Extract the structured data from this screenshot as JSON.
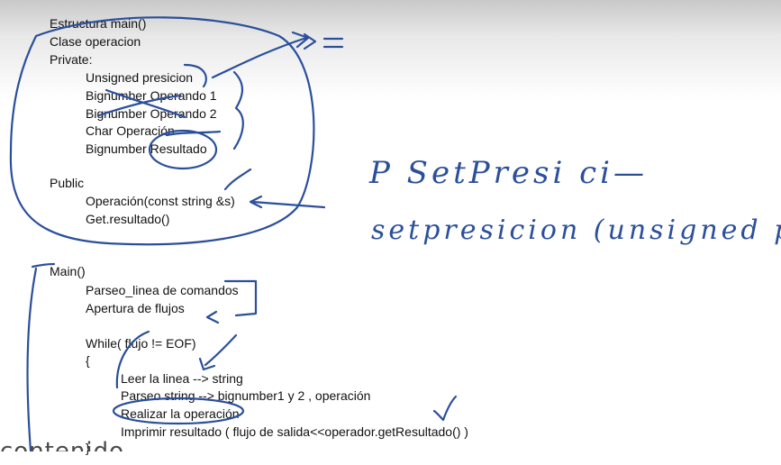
{
  "document": {
    "lines": [
      "Estructura main()",
      "Clase operacion",
      "Private:",
      "Unsigned presicion",
      "Bignumber Operando 1",
      "Bignumber Operando 2",
      "Char Operación",
      "Bignumber Resultado",
      "Public",
      "Operación(const string &s)",
      "Get.resultado()",
      "Main()",
      "Parseo_linea de comandos",
      "Apertura de flujos",
      "While( flujo != EOF)",
      "{",
      "Leer la linea --> string",
      "Parseo string --> bignumber1 y 2 , operación",
      "Realizar la operación",
      "Imprimir resultado ( flujo de salida<<operador.getResultado() )",
      "}"
    ]
  },
  "handwriting": {
    "arrow_eq": "= ",
    "line1": "P   SetPresi ci—",
    "line2": "setpresicion (unsigned p)"
  },
  "watermark": "contenido",
  "colors": {
    "ink": "#2b4f9b",
    "text": "#111111"
  }
}
